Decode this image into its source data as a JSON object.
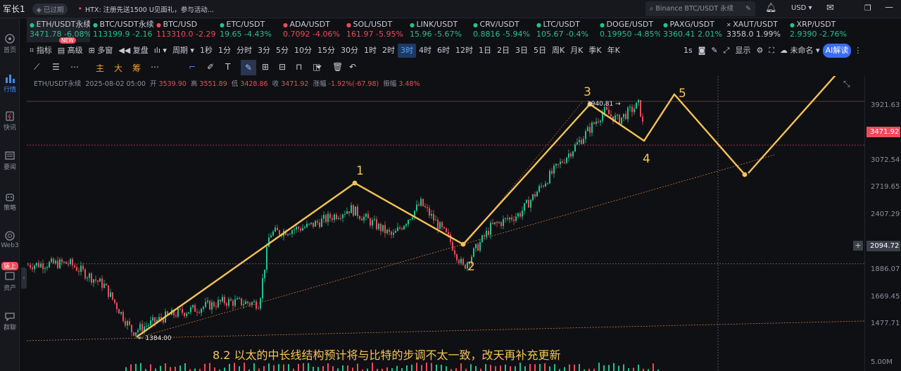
{
  "top": {
    "user": "军长1",
    "status": "已过期",
    "announce": "HTX:  注册先送1500 U见面礼，参与活动...",
    "search_placeholder": "Binance BTC/USDT 永续",
    "currency": "USD"
  },
  "sidebar": {
    "items": [
      {
        "label": "首页",
        "icon": "compass-icon"
      },
      {
        "label": "行情",
        "icon": "chart-bars-icon"
      },
      {
        "label": "快讯",
        "icon": "flash-news-icon"
      },
      {
        "label": "要闻",
        "icon": "news-icon"
      },
      {
        "label": "策略",
        "icon": "robot-icon"
      },
      {
        "label": "Web3",
        "icon": "web3-icon"
      },
      {
        "label": "资产",
        "icon": "wallet-icon"
      },
      {
        "label": "群聊",
        "icon": "chat-icon"
      }
    ],
    "badge": "链上"
  },
  "tickers": [
    {
      "name": "ETH/USDT永续",
      "price": "3471.78",
      "change": "-6.08%",
      "dir": "up"
    },
    {
      "name": "BTC/USDT永续",
      "price": "113199.9",
      "change": "-2.16",
      "dir": "up"
    },
    {
      "name": "BTC/USD",
      "price": "113310.0",
      "change": "-2.29",
      "dir": "down"
    },
    {
      "name": "ETC/USDT",
      "price": "19.65",
      "change": "-4.43%",
      "dir": "up"
    },
    {
      "name": "ADA/USDT",
      "price": "0.7092",
      "change": "-4.06%",
      "dir": "down"
    },
    {
      "name": "SOL/USDT",
      "price": "161.97",
      "change": "-5.95%",
      "dir": "down"
    },
    {
      "name": "LINK/USDT",
      "price": "15.96",
      "change": "-5.67%",
      "dir": "up"
    },
    {
      "name": "CRV/USDT",
      "price": "0.8816",
      "change": "-5.94%",
      "dir": "up"
    },
    {
      "name": "LTC/USDT",
      "price": "105.67",
      "change": "-0.4%",
      "dir": "up"
    },
    {
      "name": "DOGE/USDT",
      "price": "0.19950",
      "change": "-4.85%",
      "dir": "up"
    },
    {
      "name": "PAXG/USDT",
      "price": "3360.41",
      "change": "2.01%",
      "dir": "up"
    },
    {
      "name": "XAUT/USDT",
      "price": "3358.0",
      "change": "1.99%",
      "dir": "neu"
    },
    {
      "name": "XRP/USDT",
      "price": "2.9390",
      "change": "-2.76%",
      "dir": "up"
    }
  ],
  "new_badge": "NEW",
  "toolbar": {
    "items": [
      "指标",
      "高级",
      "多窗",
      "复盘",
      "周期",
      "1秒",
      "1分",
      "分时",
      "3分",
      "5分",
      "10分",
      "15分",
      "30分",
      "1时",
      "2时",
      "3时",
      "4时",
      "6时",
      "12时",
      "1日",
      "2日",
      "3日",
      "5日",
      "周K",
      "月K",
      "季K",
      "年K"
    ],
    "selected": "3时",
    "right": [
      "1s",
      "显示",
      "未命名",
      "AI解读"
    ]
  },
  "draw_labels": [
    "主",
    "大",
    "筹"
  ],
  "ohlc": {
    "symbol": "ETH/USDT永续",
    "time": "2025-08-02 05:00",
    "open_label": "开",
    "open": "3539.90",
    "high_label": "高",
    "high": "3551.89",
    "low_label": "低",
    "low": "3428.86",
    "close_label": "收",
    "close": "3471.92",
    "chg_label": "涨幅",
    "chg": "-1.92%(-67.98)",
    "amp_label": "振幅",
    "amp": "3.48%"
  },
  "axis": {
    "labels": [
      "3921.63",
      "3072.54",
      "2719.65",
      "2407.29",
      "1886.07",
      "1669.45",
      "1477.71",
      "5.00M"
    ],
    "price_tag": "3471.92",
    "cross_tag": "2094.72"
  },
  "annotations": {
    "low_label": "1384.00",
    "high_label": "3940.81",
    "waves": [
      "1",
      "2",
      "3",
      "4",
      "5"
    ],
    "caption": "8.2 以太的中长线结构预计将与比特的步调不太一致，改天再补充更新"
  },
  "colors": {
    "accent": "#3a8ef6",
    "wave": "#f5c454",
    "up": "#22c38e",
    "down": "#ef4b59",
    "price_line": "#ef4b59"
  }
}
